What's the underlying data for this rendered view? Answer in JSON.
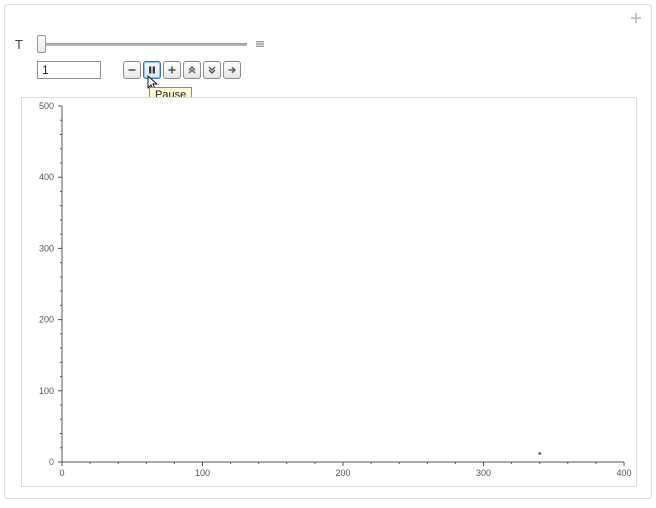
{
  "corner": {
    "tooltip": "Add"
  },
  "slider": {
    "label": "T",
    "value": 1,
    "min": 1,
    "max": 100
  },
  "input": {
    "value": "1"
  },
  "buttons": {
    "minus": "Decrease",
    "pause": "Pause",
    "plus": "Increase",
    "up": "Up",
    "down": "Down",
    "right": "Forward",
    "active": "pause",
    "tooltip": "Pause"
  },
  "chart_data": {
    "type": "scatter",
    "x": [
      340
    ],
    "y": [
      12
    ],
    "xlim": [
      0,
      400
    ],
    "ylim": [
      0,
      500
    ],
    "xticks": [
      0,
      100,
      200,
      300,
      400
    ],
    "yticks": [
      0,
      100,
      200,
      300,
      400,
      500
    ],
    "title": "",
    "xlabel": "",
    "ylabel": ""
  }
}
